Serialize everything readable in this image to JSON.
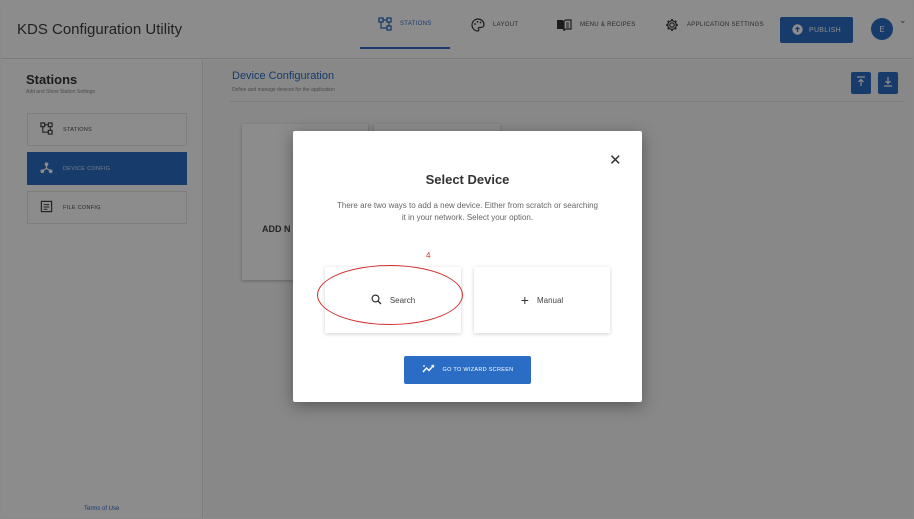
{
  "app": {
    "title": "KDS Configuration Utility"
  },
  "nav": {
    "items": [
      {
        "label": "Stations",
        "icon": "stations-icon",
        "active": true
      },
      {
        "label": "Layout",
        "icon": "palette-icon",
        "active": false
      },
      {
        "label": "Menu & Recipes",
        "icon": "menu-book-icon",
        "active": false
      },
      {
        "label": "Application Settings",
        "icon": "gear-icon",
        "active": false
      }
    ],
    "publish_label": "Publish",
    "avatar_initial": "E"
  },
  "sidebar": {
    "title": "Stations",
    "subtitle": "Add and Show Station Settings",
    "items": [
      {
        "label": "Stations",
        "icon": "stations-icon",
        "active": false
      },
      {
        "label": "Device Config",
        "icon": "device-icon",
        "active": true
      },
      {
        "label": "File Config",
        "icon": "file-icon",
        "active": false
      }
    ],
    "footer_link": "Terms of Use"
  },
  "main": {
    "title": "Device Configuration",
    "subtitle": "Define and manage devices for the application",
    "add_card_label": "ADD N"
  },
  "modal": {
    "title": "Select Device",
    "description": "There are two ways to add a new device. Either from scratch or searching it in your network. Select your option.",
    "step_annotation": "4",
    "options": [
      {
        "label": "Search",
        "icon": "search-icon"
      },
      {
        "label": "Manual",
        "icon": "plus-icon"
      }
    ],
    "wizard_button": "Go to Wizard Screen",
    "close_glyph": "✕"
  },
  "colors": {
    "accent": "#2b6cc4",
    "annotation": "#d23030"
  }
}
